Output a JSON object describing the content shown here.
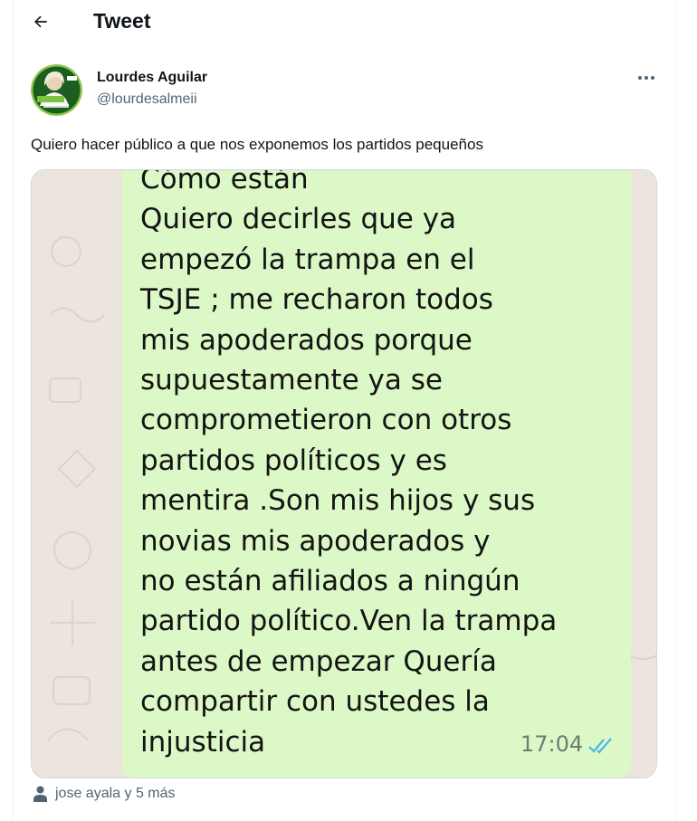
{
  "header": {
    "title": "Tweet",
    "back_icon": "arrow-left-icon"
  },
  "author": {
    "name": "Lourdes Aguilar",
    "handle": "@lourdesalmeii",
    "avatar_colors": {
      "ring": "#8ac34a",
      "background": "#1b5e20"
    }
  },
  "more_icon": "more-horizontal-icon",
  "tweet": {
    "text": "Quiero hacer público a que nos exponemos los partidos pequeños"
  },
  "media": {
    "message_lines": [
      "Cómo están",
      "Quiero decirles que ya",
      "empezó la trampa en el",
      "TSJE  ; me recharon todos",
      "mis apoderados porque",
      "supuestamente ya se",
      "comprometieron con otros",
      "partidos políticos y es",
      "mentira .Son mis hijos y sus",
      "novias mis apoderados y",
      "no están afiliados a ningún",
      "partido político.Ven la trampa",
      "antes de empezar Quería",
      "compartir con ustedes la",
      "injusticia"
    ],
    "time": "17:04",
    "read_icon": "double-check-icon",
    "colors": {
      "bubble": "#dcf8c6",
      "wallpaper": "#ece5dd",
      "ticks": "#4fb6ec"
    }
  },
  "tagged": {
    "icon": "person-icon",
    "text": "jose ayala y 5 más"
  }
}
